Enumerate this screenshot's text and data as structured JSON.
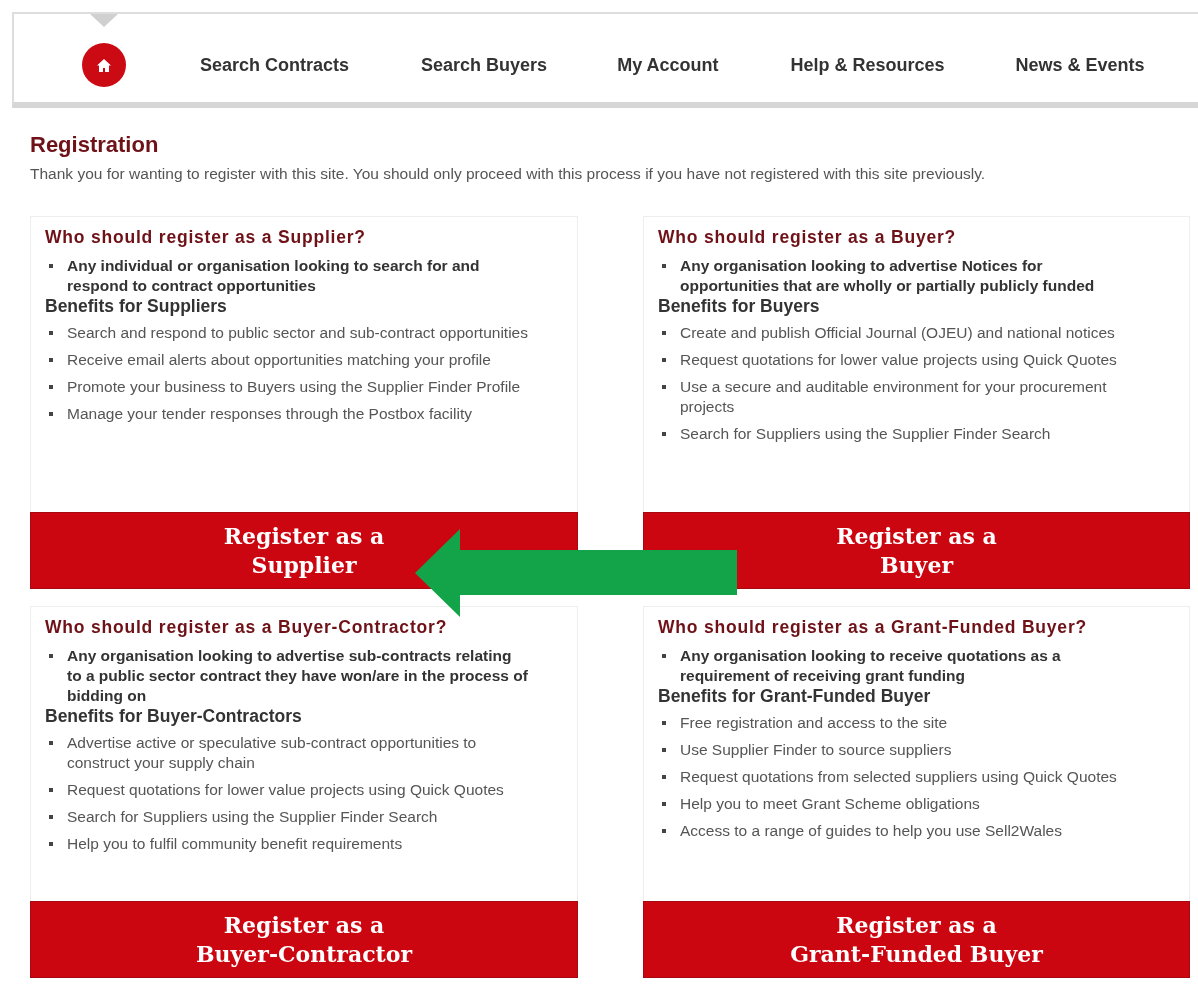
{
  "nav": {
    "items": [
      {
        "kind": "home",
        "selected": true
      },
      {
        "kind": "link",
        "label": "Search Contracts",
        "selected": false
      },
      {
        "kind": "link",
        "label": "Search Buyers",
        "selected": false
      },
      {
        "kind": "link",
        "label": "My Account",
        "selected": false
      },
      {
        "kind": "link",
        "label": "Help & Resources",
        "selected": false
      },
      {
        "kind": "link",
        "label": "News & Events",
        "selected": false
      }
    ]
  },
  "page": {
    "title": "Registration",
    "intro": "Thank you for wanting to register with this site. You should only proceed with this process if you have not registered with this site previously."
  },
  "cards": [
    {
      "title": "Who should register as a Supplier?",
      "who": [
        "Any individual or organisation looking to search for and respond to contract opportunities"
      ],
      "benefits_heading": "Benefits for Suppliers",
      "benefits": [
        "Search and respond to public sector and sub-contract opportunities",
        "Receive email alerts about opportunities matching your profile",
        "Promote your business to Buyers using the Supplier Finder Profile",
        "Manage your tender responses through the Postbox facility"
      ],
      "button": "Register as a\nSupplier"
    },
    {
      "title": "Who should register as a Buyer?",
      "who": [
        "Any organisation looking to advertise Notices for opportunities that are wholly or partially publicly funded"
      ],
      "benefits_heading": "Benefits for Buyers",
      "benefits": [
        "Create and publish Official Journal (OJEU) and national notices",
        "Request quotations for lower value projects using Quick Quotes",
        "Use a secure and auditable environment for your procurement projects",
        "Search for Suppliers using the Supplier Finder Search"
      ],
      "button": "Register as a\nBuyer"
    },
    {
      "title": "Who should register as a Buyer-Contractor?",
      "who": [
        "Any organisation looking to advertise sub-contracts relating to a public sector contract they have won/are in the process of bidding on"
      ],
      "benefits_heading": "Benefits for Buyer-Contractors",
      "benefits": [
        "Advertise active or speculative sub-contract opportunities to construct your supply chain",
        "Request quotations for lower value projects using Quick Quotes",
        "Search for Suppliers using the Supplier Finder Search",
        "Help you to fulfil community benefit requirements"
      ],
      "button": "Register as a\nBuyer-Contractor"
    },
    {
      "title": "Who should register as a Grant-Funded Buyer?",
      "who": [
        "Any organisation looking to receive quotations as a requirement of receiving grant funding"
      ],
      "benefits_heading": "Benefits for Grant-Funded Buyer",
      "benefits": [
        "Free registration and access to the site",
        "Use Supplier Finder to source suppliers",
        "Request quotations from selected suppliers using Quick Quotes",
        "Help you to meet Grant Scheme obligations",
        "Access to a range of guides to help you use Sell2Wales"
      ],
      "button": "Register as a\nGrant-Funded Buyer"
    }
  ],
  "annotations": [
    {
      "kind": "arrow"
    }
  ]
}
